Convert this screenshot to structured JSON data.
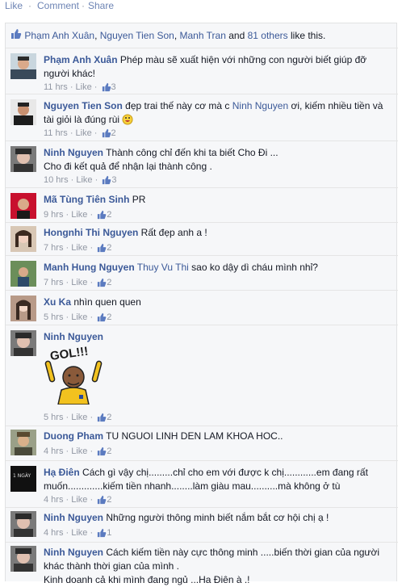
{
  "actions": {
    "like": "Like",
    "comment": "Comment",
    "share": "Share",
    "sep": "·"
  },
  "likes_summary": {
    "names": [
      "Phạm Anh Xuân",
      "Nguyen Tien Son",
      "Manh Tran"
    ],
    "comma": ",",
    "and": "and",
    "others": "81 others",
    "suffix": "like this."
  },
  "colors": {
    "link": "#3b5998",
    "meta": "#9197a3",
    "panel": "#f6f7f9"
  },
  "comments": [
    {
      "name": "Phạm Anh Xuân",
      "text": "Phép màu sẽ xuất hiện với những con người biết giúp đỡ người khác!",
      "time": "11 hrs",
      "like": "Like",
      "count": "3"
    },
    {
      "name": "Nguyen Tien Son",
      "text": "đẹp trai thế này cơ mà c",
      "mention": "Ninh Nguyen",
      "text2": "ơi, kiếm nhiều tiền và tài giỏi là đúng rùi",
      "time": "11 hrs",
      "like": "Like",
      "count": "2"
    },
    {
      "name": "Ninh Nguyen",
      "text": "Thành công chỉ đến khi ta biết Cho Đi ...",
      "text2": "Cho đi kết quả để nhận lại thành công .",
      "time": "10 hrs",
      "like": "Like",
      "count": "3"
    },
    {
      "name": "Mã Tùng Tiên Sinh",
      "text": "PR",
      "time": "9 hrs",
      "like": "Like",
      "count": "2"
    },
    {
      "name": "Hongnhi Thi Nguyen",
      "text": "Rất đẹp anh a !",
      "time": "7 hrs",
      "like": "Like",
      "count": "2"
    },
    {
      "name": "Manh Hung Nguyen",
      "mention": "Thuy Vu Thi",
      "text": "sao ko dậy dì cháu mình nhỉ?",
      "time": "7 hrs",
      "like": "Like",
      "count": "2"
    },
    {
      "name": "Xu Ka",
      "text": "nhìn quen quen",
      "time": "5 hrs",
      "like": "Like",
      "count": "2"
    },
    {
      "name": "Ninh Nguyen",
      "sticker_text": "GOL!!!",
      "time": "5 hrs",
      "like": "Like",
      "count": "2"
    },
    {
      "name": "Duong Pham",
      "text": "TU NGUOI LINH DEN LAM KHOA HOC..",
      "time": "4 hrs",
      "like": "Like",
      "count": "2"
    },
    {
      "name": "Hạ Điên",
      "avatar_text": "1 NGÀY",
      "text": "Cách gì vậy chị.........chỉ cho em với được k chị............em đang rất muốn.............kiếm tiền nhanh........làm giàu mau..........mà không ở tù",
      "time": "4 hrs",
      "like": "Like",
      "count": "2"
    },
    {
      "name": "Ninh Nguyen",
      "text": "Những người thông minh biết nắm bắt cơ hội chị ạ !",
      "time": "4 hrs",
      "like": "Like",
      "count": "1"
    },
    {
      "name": "Ninh Nguyen",
      "text": "Cách kiếm tiền này cực thông minh .....biến thời gian của người khác thành thời gian của mình .",
      "text2": "Kinh doanh cả khi mình đang ngủ ...Ha Điên à .!",
      "time": "",
      "like": "",
      "count": ""
    }
  ]
}
